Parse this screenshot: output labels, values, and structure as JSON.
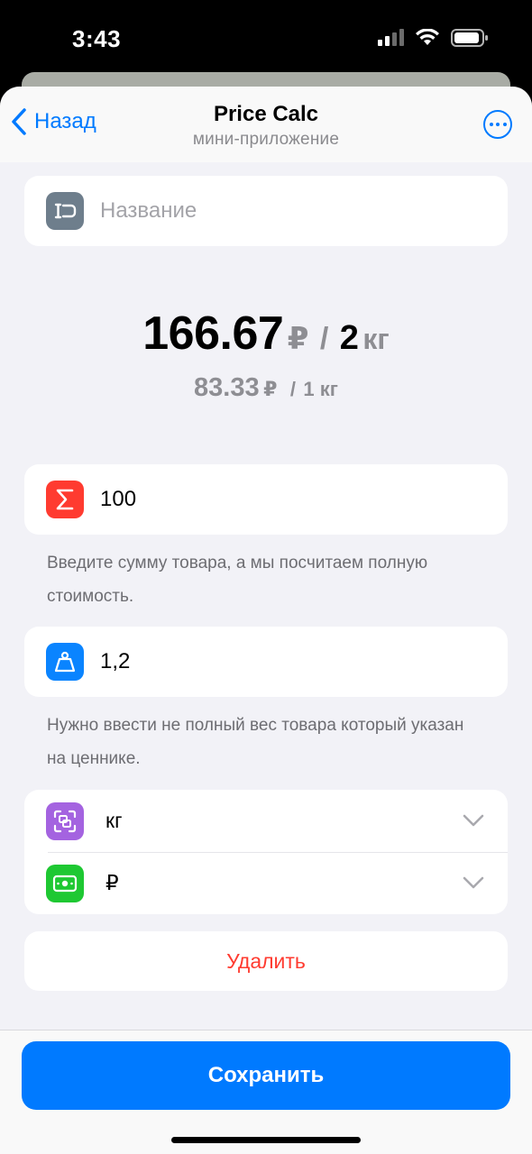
{
  "status_bar": {
    "time": "3:43"
  },
  "nav": {
    "back_label": "Назад",
    "title": "Price Calc",
    "subtitle": "мини-приложение"
  },
  "name_field": {
    "placeholder": "Название",
    "icon": "tag-icon",
    "icon_color": "#6e7e8c"
  },
  "result": {
    "price": "166.67",
    "currency": "₽",
    "separator": "/",
    "quantity": "2",
    "unit": "кг",
    "unit_price": "83.33",
    "unit_price_currency": "₽",
    "unit_separator": "/",
    "unit_quantity": "1 кг"
  },
  "sum_field": {
    "value": "100",
    "icon": "sigma-icon",
    "icon_color": "#ff3b30"
  },
  "sum_hint": "Введите сумму товара, а мы посчитаем полную стоимость.",
  "weight_field": {
    "value": "1,2",
    "icon": "weight-icon",
    "icon_color": "#0a84ff"
  },
  "weight_hint": "Нужно ввести не полный вес товара который указан на ценнике.",
  "unit_select": {
    "value": "кг",
    "icon": "scale-frame-icon",
    "icon_color": "#a463e0"
  },
  "currency_select": {
    "value": "₽",
    "icon": "banknote-icon",
    "icon_color": "#1ec832"
  },
  "delete_label": "Удалить",
  "save_label": "Сохранить",
  "colors": {
    "accent": "#007aff",
    "destructive": "#ff3b30",
    "background": "#f2f2f7"
  }
}
